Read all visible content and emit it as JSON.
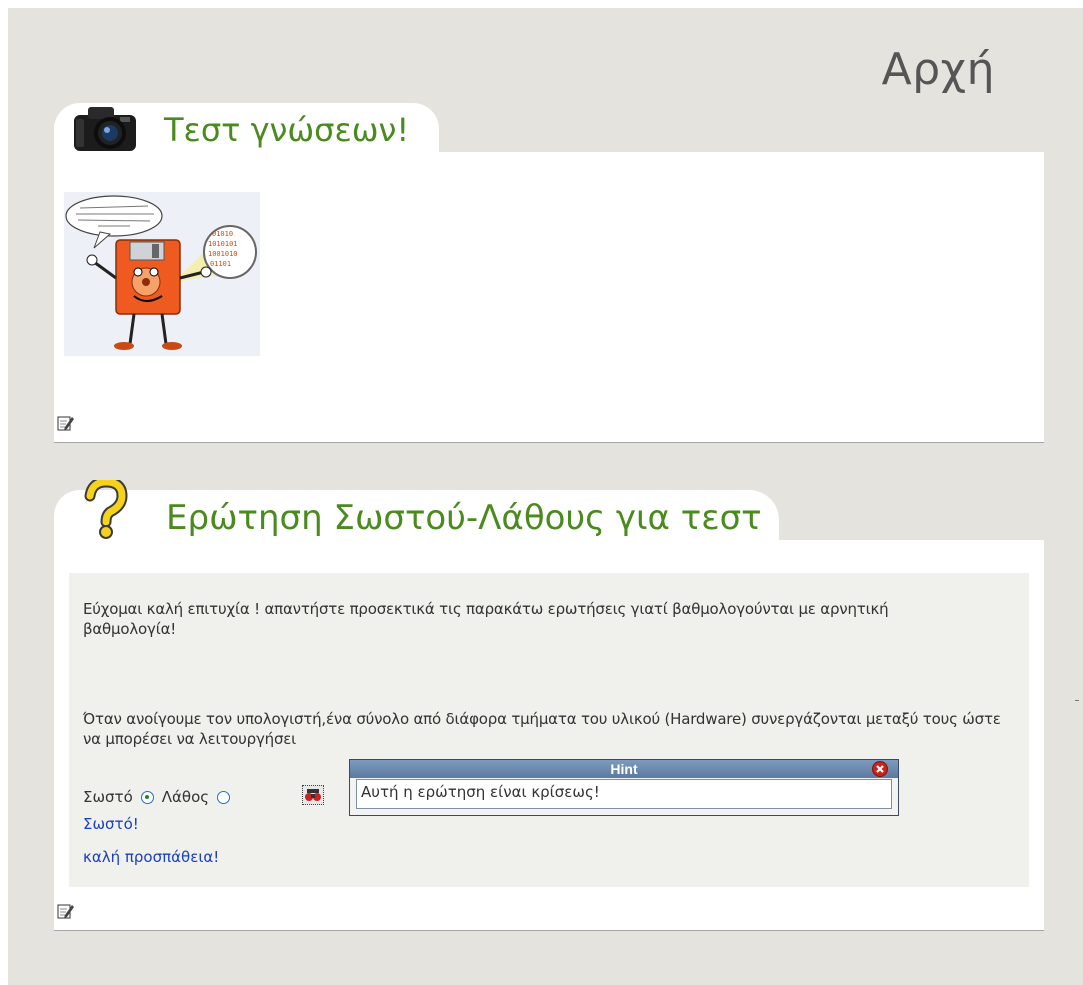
{
  "page": {
    "title": "Αρχή"
  },
  "panels": [
    {
      "title": "Τεστ γνώσεων!",
      "icon": "camera-icon"
    },
    {
      "title": "Ερώτηση Σωστού-Λάθους για τεστ",
      "icon": "question-mark-icon"
    }
  ],
  "quiz": {
    "intro": "Εύχομαι καλή επιτυχία ! απαντήστε προσεκτικά τις παρακάτω ερωτήσεις γιατί βαθμολογούνται με αρνητική βαθμολογία!",
    "question": "Όταν ανοίγουμε τον υπολογιστή,ένα σύνολο από διάφορα τμήματα του υλικού (Hardware) συνεργάζονται μεταξύ τους ώστε να μπορέσει να λειτουργήσει",
    "options": [
      {
        "label": "Σωστό",
        "selected": true
      },
      {
        "label": "Λάθος",
        "selected": false
      }
    ],
    "feedback": "Σωστό!",
    "encouragement": "καλή προσπάθεια!",
    "hint": {
      "title": "Hint",
      "text": "Αυτή η ερώτηση είναι κρίσεως!"
    }
  },
  "colors": {
    "title_green": "#4a8a1f",
    "feedback_blue": "#1a3fbf",
    "background": "#e4e3dd"
  }
}
